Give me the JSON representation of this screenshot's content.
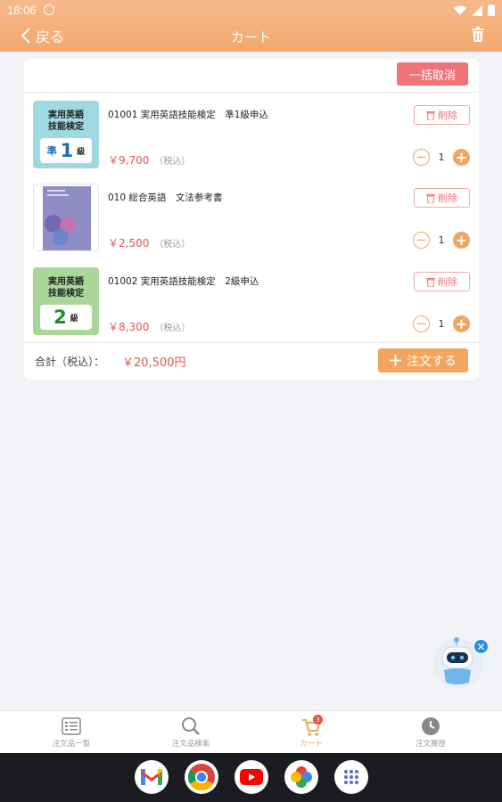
{
  "status_bar": {
    "time": "18:06"
  },
  "header": {
    "back_label": "戻る",
    "title": "カート"
  },
  "cart": {
    "bulk_cancel_label": "一括取消",
    "delete_label": "削除",
    "tax_note": "（税込）",
    "items": [
      {
        "name": "01001 実用英語技能検定　準1級申込",
        "price": "￥9,700",
        "quantity": "1",
        "thumb": {
          "title_line1": "実用英語",
          "title_line2": "技能検定",
          "grade_prefix": "準",
          "grade": "1",
          "grade_suffix": "級"
        }
      },
      {
        "name": "010 総合英語　文法参考書",
        "price": "￥2,500",
        "quantity": "1"
      },
      {
        "name": "01002 実用英語技能検定　2級申込",
        "price": "￥8,300",
        "quantity": "1",
        "thumb": {
          "title_line1": "実用英語",
          "title_line2": "技能検定",
          "grade": "2",
          "grade_suffix": "級"
        }
      }
    ],
    "total_label": "合計（税込）：",
    "total_amount": "￥20,500円",
    "order_label": "注文する"
  },
  "tabbar": {
    "tabs": [
      {
        "label": "注文品一覧",
        "icon": "list-icon"
      },
      {
        "label": "注文品検索",
        "icon": "search-icon"
      },
      {
        "label": "カート",
        "icon": "cart-icon",
        "badge": "3"
      },
      {
        "label": "注文履歴",
        "icon": "clock-icon"
      }
    ]
  },
  "dock": {
    "apps": [
      "gmail-icon",
      "chrome-icon",
      "youtube-icon",
      "photos-icon",
      "app-drawer-icon"
    ]
  },
  "colors": {
    "accent": "#f1a55e",
    "price": "#ef4f4f",
    "danger": "#f0737a",
    "header_top": "#f6b98a"
  }
}
